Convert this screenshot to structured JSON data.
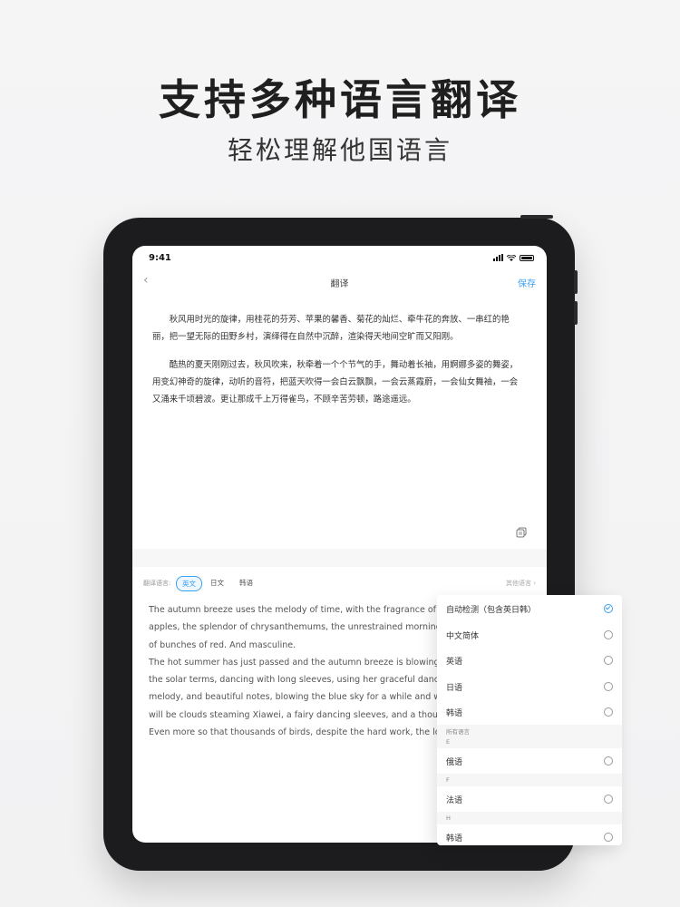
{
  "headline": "支持多种语言翻译",
  "subline": "轻松理解他国语言",
  "status_bar": {
    "time": "9:41"
  },
  "nav": {
    "back": "‹",
    "title": "翻译",
    "save": "保存"
  },
  "source_paragraphs": [
    [
      "秋风用时光的旋律，用桂花的芬芳、苹果的馨香、菊花的灿烂、牵牛花的奔放、一串红的艳",
      "丽，把一望无际的田野乡村，演绎得在自然中沉醉，渲染得天地间空旷而又阳刚。"
    ],
    [
      "酷热的夏天刚刚过去，秋风吹来，秋牵着一个个节气的手，舞动着长袖，用婀娜多姿的舞姿，",
      "用变幻神奇的旋律，动听的音符，把蓝天吹得一会白云飘飘，一会云蒸霞蔚，一会仙女舞袖，一会",
      "又涌来千顷碧波。更让那成千上万得雀鸟，不顾辛苦劳顿，路途遥远。"
    ]
  ],
  "lang_bar": {
    "label": "翻译语言:",
    "options": [
      "英文",
      "日文",
      "韩语"
    ],
    "active": "英文",
    "other": "其他语言 ›"
  },
  "target_lines": [
    "The autumn breeze uses the melody of time, with the fragrance of osma",
    "apples, the splendor of chrysanthemums, the unrestrained morning glory",
    "of bunches of red. And masculine.",
    "The hot summer has just passed and the autumn breeze is blowing. Qiu",
    "the solar terms, dancing with long sleeves, using her graceful dance pos",
    "melody, and beautiful notes, blowing the blue sky for a while and white",
    "will be clouds steaming Xiawei, a fairy dancing sleeves, and a thousand",
    "Even more so that thousands of birds, despite the hard work, the long jo"
  ],
  "dropdown": {
    "top_options": [
      {
        "label": "自动检测（包含英日韩）",
        "checked": true
      },
      {
        "label": "中文简体",
        "checked": false
      },
      {
        "label": "英语",
        "checked": false
      },
      {
        "label": "日语",
        "checked": false
      },
      {
        "label": "韩语",
        "checked": false
      }
    ],
    "all_label": "所有语言",
    "sections": [
      {
        "letter": "E",
        "options": [
          {
            "label": "俄语",
            "checked": false
          }
        ]
      },
      {
        "letter": "F",
        "options": [
          {
            "label": "法语",
            "checked": false
          }
        ]
      },
      {
        "letter": "H",
        "options": [
          {
            "label": "韩语",
            "checked": false
          }
        ]
      }
    ]
  },
  "colors": {
    "accent": "#3aa0f0",
    "frame": "#1c1c1e"
  }
}
